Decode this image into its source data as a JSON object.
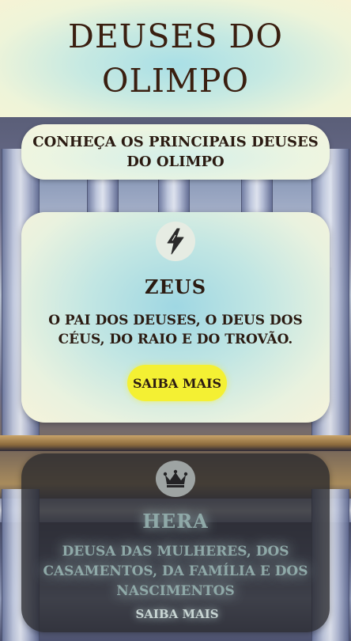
{
  "header": {
    "title": "DEUSES DO OLIMPO"
  },
  "intro": {
    "text": "CONHEÇA OS PRINCIPAIS DEUSES DO OLIMPO"
  },
  "gods": [
    {
      "name": "ZEUS",
      "icon": "lightning-bolt-icon",
      "description": "O PAI DOS DEUSES, O DEUS DOS CÉUS, DO RAIO E DO TROVÃO.",
      "button_label": "SAIBA MAIS",
      "button_color": "#f4f033"
    },
    {
      "name": "HERA",
      "icon": "crown-icon",
      "description": "DEUSA DAS MULHERES, DOS CASAMENTOS, DA FAMÍLIA E DOS NASCIMENTOS",
      "button_label": "SAIBA MAIS"
    }
  ]
}
